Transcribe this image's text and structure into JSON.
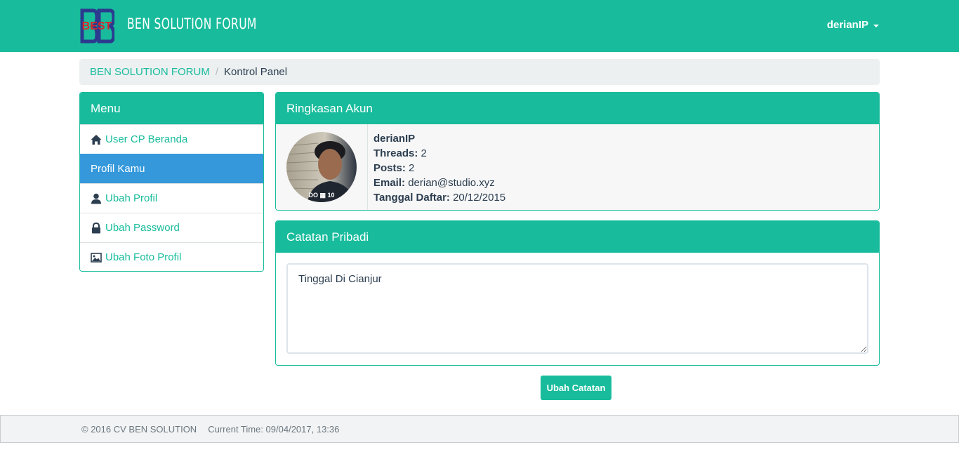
{
  "header": {
    "brand_title": "BEN SOLUTION FORUM",
    "logo_text": "BEST",
    "user_menu_label": "derianIP"
  },
  "breadcrumb": {
    "home": "BEN SOLUTION FORUM",
    "separator": "/",
    "current": "Kontrol Panel"
  },
  "menu": {
    "title": "Menu",
    "items": [
      {
        "label": "User CP Beranda",
        "icon": "home-icon"
      },
      {
        "label": "Profil Kamu",
        "icon": ""
      },
      {
        "label": "Ubah Profil",
        "icon": "user-icon"
      },
      {
        "label": "Ubah Password",
        "icon": "lock-icon"
      },
      {
        "label": "Ubah Foto Profil",
        "icon": "picture-icon"
      }
    ]
  },
  "account": {
    "title": "Ringkasan Akun",
    "username": "derianIP",
    "threads_label": "Threads:",
    "threads_value": "2",
    "posts_label": "Posts:",
    "posts_value": "2",
    "email_label": "Email:",
    "email_value": "derian@studio.xyz",
    "joined_label": "Tanggal Daftar:",
    "joined_value": "20/12/2015",
    "avatar_caption": "DO ▦ 10"
  },
  "notes": {
    "title": "Catatan Pribadi",
    "value": "Tinggal Di Cianjur",
    "button_label": "Ubah Catatan"
  },
  "footer": {
    "copyright": "© 2016 CV BEN SOLUTION",
    "time": "Current Time: 09/04/2017, 13:36"
  },
  "colors": {
    "primary": "#18bc9c",
    "active": "#3498db",
    "text": "#2c3e50"
  }
}
